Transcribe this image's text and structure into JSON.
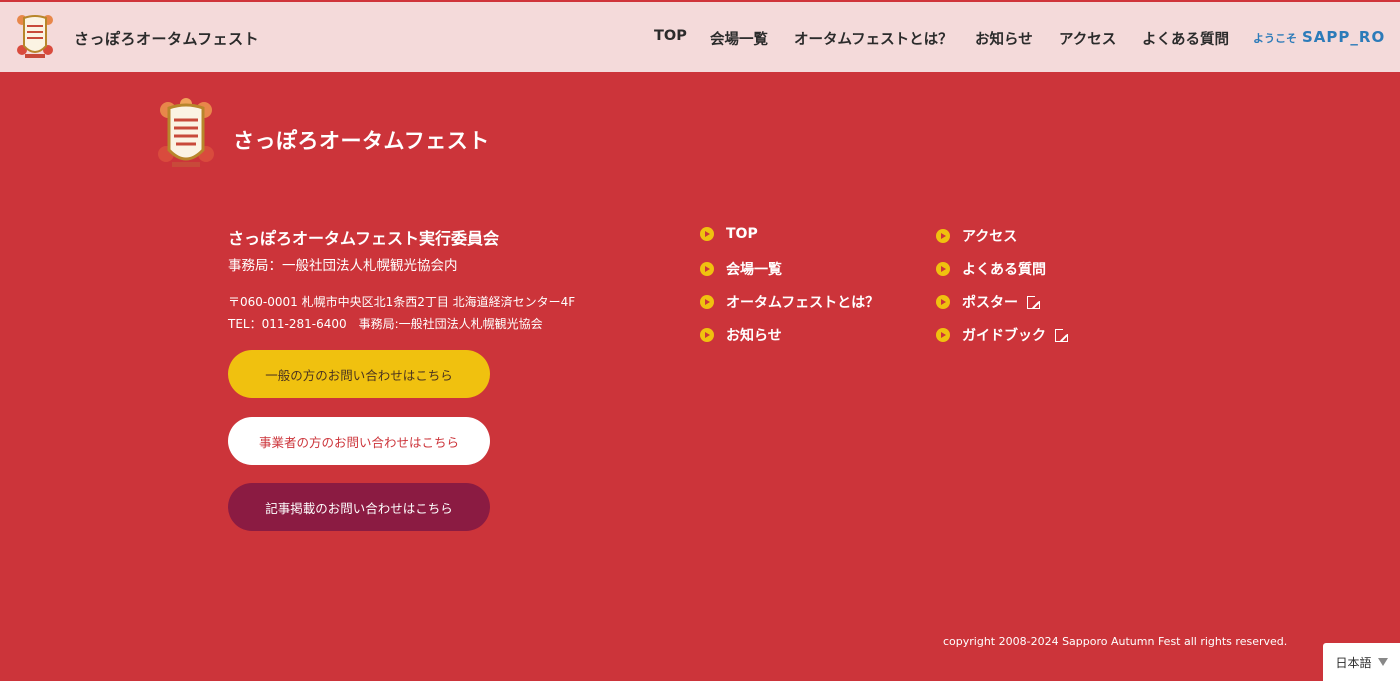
{
  "header": {
    "site_title": "さっぽろオータムフェスト",
    "nav": [
      "TOP",
      "会場一覧",
      "オータムフェストとは？",
      "お知らせ",
      "アクセス",
      "よくある質問"
    ],
    "welcome_small": "ようこそ",
    "welcome_big": "SAPP_RO"
  },
  "footer": {
    "brand_title": "さっぽろオータムフェスト",
    "org_name": "さっぽろオータムフェスト実行委員会",
    "org_office": "事務局：一般社団法人札幌観光協会内",
    "address": "〒060-0001 札幌市中央区北1条西2丁目 北海道経済センター4F",
    "tel": "TEL：011-281-6400　事務局:一般社団法人札幌観光協会",
    "buttons": {
      "general": "一般の方のお問い合わせはこちら",
      "business": "事業者の方のお問い合わせはこちら",
      "media": "記事掲載のお問い合わせはこちら"
    },
    "links_left": [
      "TOP",
      "会場一覧",
      "オータムフェストとは？",
      "お知らせ"
    ],
    "links_right": [
      "アクセス",
      "よくある質問",
      "ポスター",
      "ガイドブック"
    ],
    "copyright": "copyright 2008-2024 Sapporo Autumn Fest all rights reserved."
  },
  "language": {
    "selected": "日本語"
  },
  "colors": {
    "background": "#cc343a",
    "header_bg": "#f4dada",
    "accent_yellow": "#f0c10f",
    "media_button": "#8b1b42"
  }
}
